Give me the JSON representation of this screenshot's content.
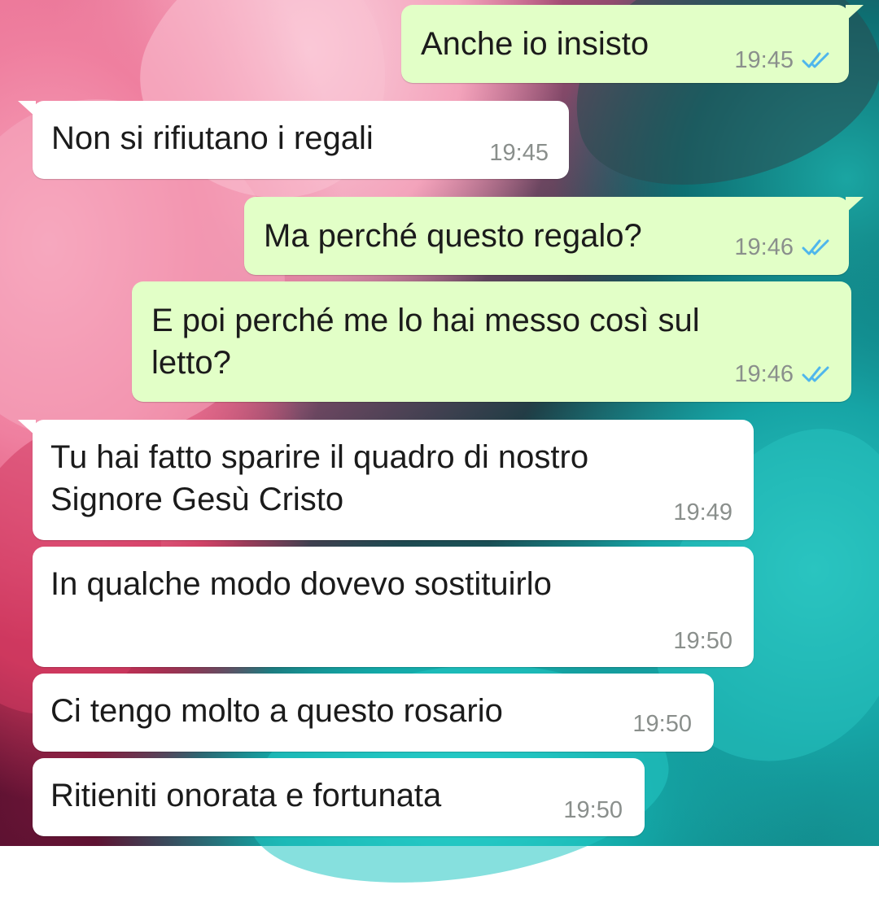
{
  "messages": [
    {
      "direction": "out",
      "text": "Anche io insisto",
      "time": "19:45",
      "status": "read-double-check"
    },
    {
      "direction": "in",
      "text": "Non si rifiutano i regali",
      "time": "19:45"
    },
    {
      "direction": "out",
      "text": "Ma perché questo regalo?",
      "time": "19:46",
      "status": "read-double-check"
    },
    {
      "direction": "out",
      "text": "E poi perché me lo hai messo così sul\nletto?",
      "time": "19:46",
      "status": "read-double-check"
    },
    {
      "direction": "in",
      "text": "Tu hai fatto sparire il quadro di nostro\nSignore Gesù Cristo",
      "time": "19:49"
    },
    {
      "direction": "in",
      "text": "In qualche modo dovevo sostituirlo",
      "time": "19:50"
    },
    {
      "direction": "in",
      "text": "Ci tengo molto a questo rosario",
      "time": "19:50"
    },
    {
      "direction": "in",
      "text": "Ritieniti onorata e fortunata",
      "time": "19:50"
    }
  ],
  "colors": {
    "outgoing_bubble": "#e2ffc7",
    "incoming_bubble": "#ffffff",
    "read_ticks": "#4fb6ec",
    "timestamp": "#8a8f8c"
  },
  "icons": {
    "read_status": "double-check-icon"
  }
}
